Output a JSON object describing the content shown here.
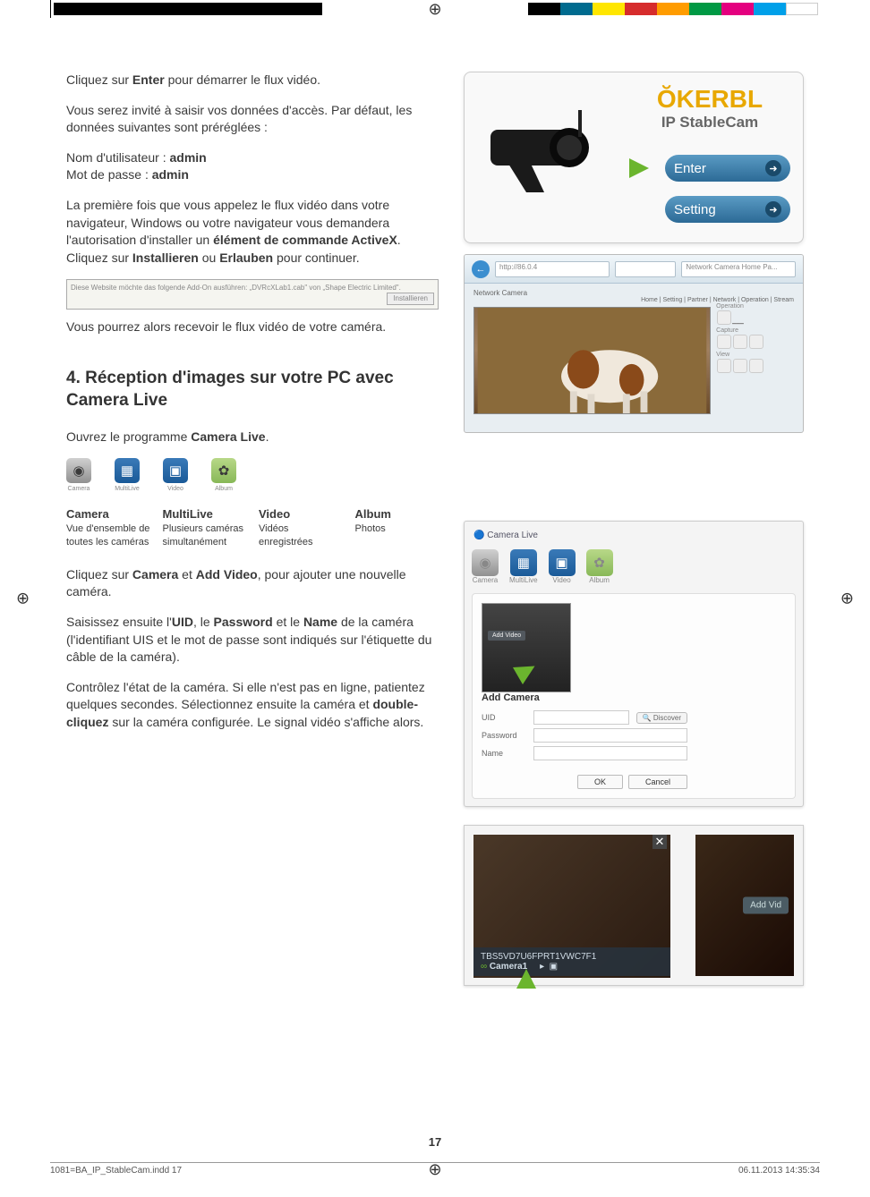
{
  "intro": {
    "p1a": "Cliquez sur ",
    "p1b": "Enter",
    "p1c": " pour démarrer le flux vidéo.",
    "p2": "Vous serez invité à saisir vos données d'accès. Par défaut, les données suivantes sont préréglées :",
    "user_label": "Nom d'utilisateur : ",
    "user_value": "admin",
    "pass_label": "Mot de passe : ",
    "pass_value": "admin",
    "p3a": "La première fois que vous appelez le flux vidéo dans votre navigateur, Windows ou votre navigateur vous demandera l'autorisation d'installer un ",
    "p3b": "élément de commande ActiveX",
    "p3c": ". Cliquez sur ",
    "p3d": "Installieren",
    "p3e": " ou ",
    "p3f": "Erlauben",
    "p3g": " pour continuer.",
    "p4": "Vous pourrez alors recevoir le flux vidéo de votre caméra."
  },
  "kerbl": {
    "logo": "ŎKERBL",
    "sub": "IP StableCam",
    "btn1": "Enter",
    "btn2": "Setting"
  },
  "browser": {
    "url1": "http://86.0.4",
    "url2": "Network Camera Home Pa...",
    "title": "Network Camera",
    "nav": "Home | Setting | Partner | Network | Operation | Stream",
    "op": "Operation",
    "cap": "Capture",
    "view": "View"
  },
  "install": {
    "text": "Diese Website möchte das folgende Add-On ausführen: „DVRcXLab1.cab\" von „Shape Electric Limited\".",
    "btn": "Installieren"
  },
  "section4": {
    "heading": "4. Réception d'images sur votre PC avec Camera Live",
    "p1a": "Ouvrez le programme ",
    "p1b": "Camera Live",
    "p1c": "."
  },
  "icons": {
    "camera": {
      "cap": "Camera",
      "title": "Camera",
      "desc": "Vue d'ensemble de toutes les caméras"
    },
    "multilive": {
      "cap": "MultiLive",
      "title": "MultiLive",
      "desc": "Plusieurs caméras simultanément"
    },
    "video": {
      "cap": "Video",
      "title": "Video",
      "desc": "Vidéos enregistrées"
    },
    "album": {
      "cap": "Album",
      "title": "Album",
      "desc": "Photos"
    }
  },
  "sec4_body": {
    "p1a": "Cliquez sur ",
    "p1b": "Camera",
    "p1c": " et ",
    "p1d": "Add Video",
    "p1e": ", pour ajouter une nouvelle caméra.",
    "p2a": "Saisissez ensuite l'",
    "p2b": "UID",
    "p2c": ", le ",
    "p2d": "Password",
    "p2e": " et le ",
    "p2f": "Name",
    "p2g": " de la caméra",
    "p3": "(l'identifiant UIS et le mot de passe sont indiqués sur l'étiquette du câble de la caméra).",
    "p4a": "Contrôlez l'état de la caméra. Si elle n'est pas en ligne, patientez quelques secondes. Sélectionnez ensuite la caméra et ",
    "p4b": "double-cliquez",
    "p4c": " sur la caméra configurée. Le signal vidéo s'affiche alors."
  },
  "camlive": {
    "header": "Camera Live",
    "tabs": {
      "camera": "Camera",
      "multilive": "MultiLive",
      "video": "Video",
      "album": "Album"
    },
    "panel_title": "Add Camera",
    "uid": "UID",
    "password": "Password",
    "name": "Name",
    "discover": "🔍 Discover",
    "ok": "OK",
    "cancel": "Cancel",
    "small_tag": "Add Video"
  },
  "liveshot": {
    "uid": "TBS5VD7U6FPRT1VWC7F1",
    "name": "Camera1",
    "close": "✕",
    "addvid": "Add Vid"
  },
  "page_num": "17",
  "footer": {
    "left": "1081=BA_IP_StableCam.indd   17",
    "right": "06.11.2013   14:35:34"
  }
}
